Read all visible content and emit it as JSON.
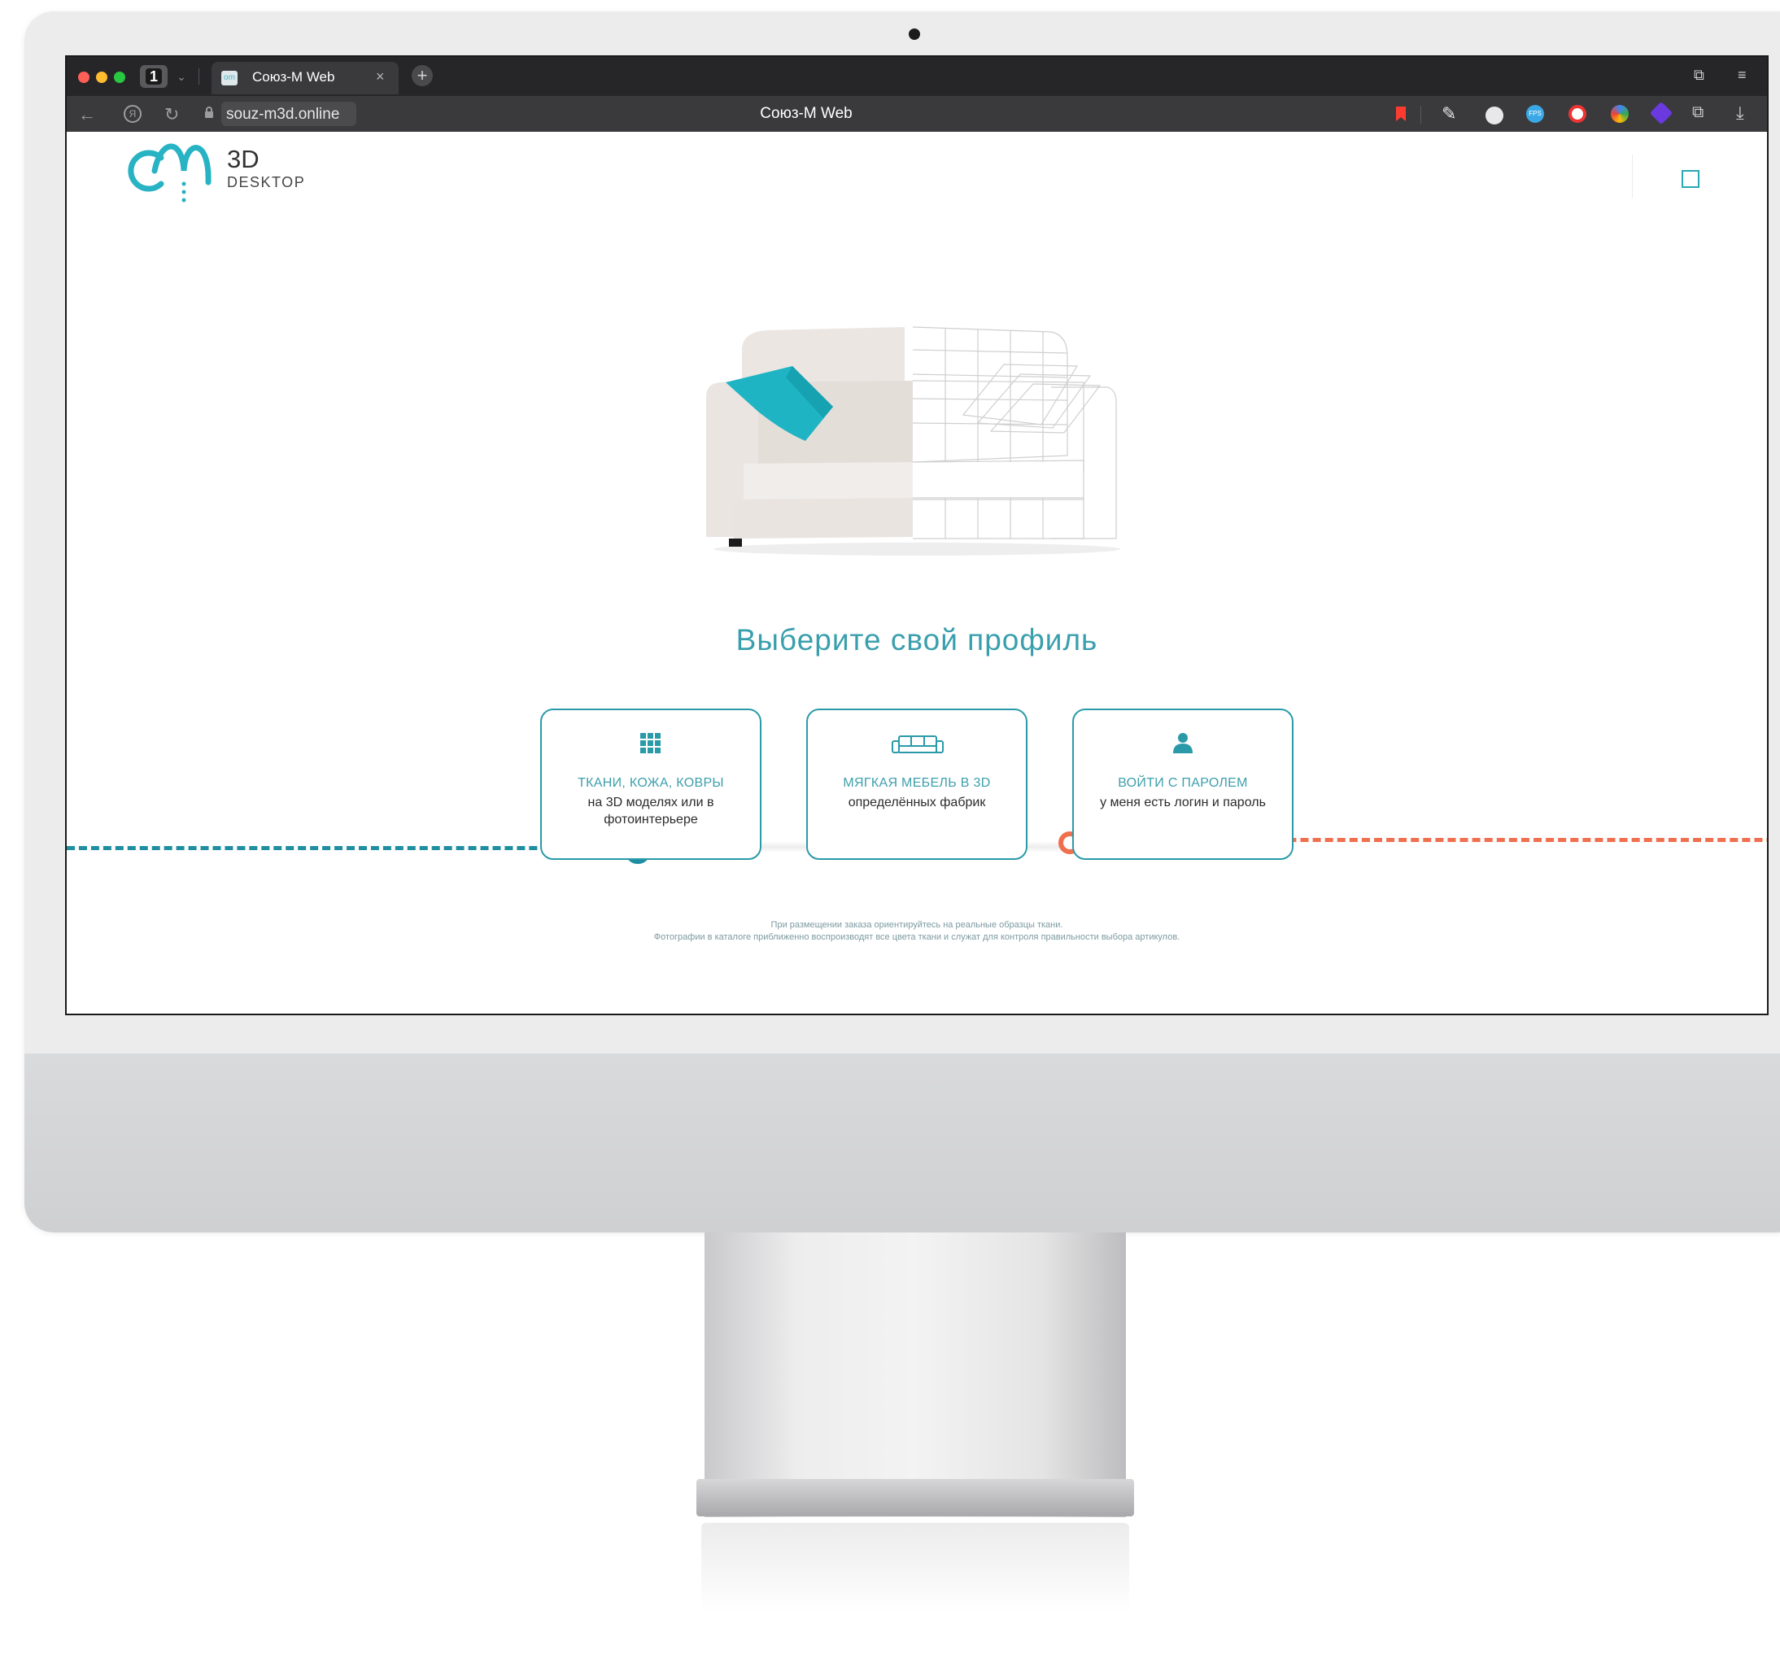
{
  "browser": {
    "tab_count": "1",
    "tab_title": "Союз-М Web",
    "favicon_text": "om",
    "url": "souz-m3d.online",
    "page_title": "Союз-М Web"
  },
  "logo": {
    "line1": "3D",
    "line2": "DESKTOP"
  },
  "main": {
    "headline": "Выберите свой профиль",
    "cards": [
      {
        "title": "ТКАНИ, КОЖА, КОВРЫ",
        "subtitle": "на 3D моделях или в фотоинтерьере",
        "icon": "grid-icon"
      },
      {
        "title": "МЯГКАЯ МЕБЕЛЬ В 3D",
        "subtitle": "определённых фабрик",
        "icon": "sofa-icon"
      },
      {
        "title": "ВОЙТИ С ПАРОЛЕМ",
        "subtitle": "у меня есть логин и пароль",
        "icon": "user-icon"
      }
    ],
    "disclaimer_line1": "При размещении заказа ориентируйтесь на реальные образцы ткани.",
    "disclaimer_line2": "Фотографии в каталоге приближенно воспроизводят все цвета ткани и служат для контроля правильности выбора артикулов."
  },
  "colors": {
    "accent": "#2aa7b4",
    "accent_dark": "#1e8ea0",
    "orange": "#ef6f4f",
    "pillow": "#1fb4c4"
  }
}
